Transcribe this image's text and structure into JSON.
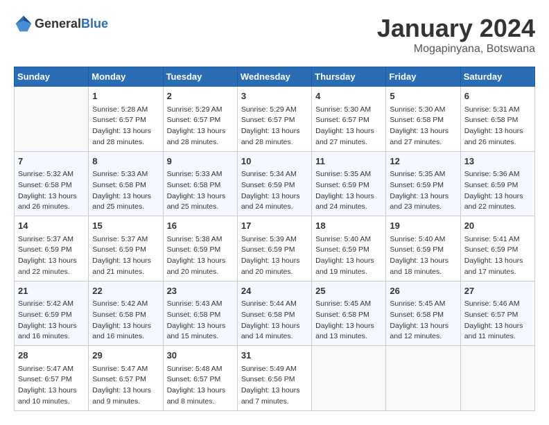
{
  "header": {
    "logo_general": "General",
    "logo_blue": "Blue",
    "title": "January 2024",
    "subtitle": "Mogapinyana, Botswana"
  },
  "days_of_week": [
    "Sunday",
    "Monday",
    "Tuesday",
    "Wednesday",
    "Thursday",
    "Friday",
    "Saturday"
  ],
  "weeks": [
    [
      {
        "day": "",
        "sunrise": "",
        "sunset": "",
        "daylight": ""
      },
      {
        "day": "1",
        "sunrise": "Sunrise: 5:28 AM",
        "sunset": "Sunset: 6:57 PM",
        "daylight": "Daylight: 13 hours and 28 minutes."
      },
      {
        "day": "2",
        "sunrise": "Sunrise: 5:29 AM",
        "sunset": "Sunset: 6:57 PM",
        "daylight": "Daylight: 13 hours and 28 minutes."
      },
      {
        "day": "3",
        "sunrise": "Sunrise: 5:29 AM",
        "sunset": "Sunset: 6:57 PM",
        "daylight": "Daylight: 13 hours and 28 minutes."
      },
      {
        "day": "4",
        "sunrise": "Sunrise: 5:30 AM",
        "sunset": "Sunset: 6:57 PM",
        "daylight": "Daylight: 13 hours and 27 minutes."
      },
      {
        "day": "5",
        "sunrise": "Sunrise: 5:30 AM",
        "sunset": "Sunset: 6:58 PM",
        "daylight": "Daylight: 13 hours and 27 minutes."
      },
      {
        "day": "6",
        "sunrise": "Sunrise: 5:31 AM",
        "sunset": "Sunset: 6:58 PM",
        "daylight": "Daylight: 13 hours and 26 minutes."
      }
    ],
    [
      {
        "day": "7",
        "sunrise": "Sunrise: 5:32 AM",
        "sunset": "Sunset: 6:58 PM",
        "daylight": "Daylight: 13 hours and 26 minutes."
      },
      {
        "day": "8",
        "sunrise": "Sunrise: 5:33 AM",
        "sunset": "Sunset: 6:58 PM",
        "daylight": "Daylight: 13 hours and 25 minutes."
      },
      {
        "day": "9",
        "sunrise": "Sunrise: 5:33 AM",
        "sunset": "Sunset: 6:58 PM",
        "daylight": "Daylight: 13 hours and 25 minutes."
      },
      {
        "day": "10",
        "sunrise": "Sunrise: 5:34 AM",
        "sunset": "Sunset: 6:59 PM",
        "daylight": "Daylight: 13 hours and 24 minutes."
      },
      {
        "day": "11",
        "sunrise": "Sunrise: 5:35 AM",
        "sunset": "Sunset: 6:59 PM",
        "daylight": "Daylight: 13 hours and 24 minutes."
      },
      {
        "day": "12",
        "sunrise": "Sunrise: 5:35 AM",
        "sunset": "Sunset: 6:59 PM",
        "daylight": "Daylight: 13 hours and 23 minutes."
      },
      {
        "day": "13",
        "sunrise": "Sunrise: 5:36 AM",
        "sunset": "Sunset: 6:59 PM",
        "daylight": "Daylight: 13 hours and 22 minutes."
      }
    ],
    [
      {
        "day": "14",
        "sunrise": "Sunrise: 5:37 AM",
        "sunset": "Sunset: 6:59 PM",
        "daylight": "Daylight: 13 hours and 22 minutes."
      },
      {
        "day": "15",
        "sunrise": "Sunrise: 5:37 AM",
        "sunset": "Sunset: 6:59 PM",
        "daylight": "Daylight: 13 hours and 21 minutes."
      },
      {
        "day": "16",
        "sunrise": "Sunrise: 5:38 AM",
        "sunset": "Sunset: 6:59 PM",
        "daylight": "Daylight: 13 hours and 20 minutes."
      },
      {
        "day": "17",
        "sunrise": "Sunrise: 5:39 AM",
        "sunset": "Sunset: 6:59 PM",
        "daylight": "Daylight: 13 hours and 20 minutes."
      },
      {
        "day": "18",
        "sunrise": "Sunrise: 5:40 AM",
        "sunset": "Sunset: 6:59 PM",
        "daylight": "Daylight: 13 hours and 19 minutes."
      },
      {
        "day": "19",
        "sunrise": "Sunrise: 5:40 AM",
        "sunset": "Sunset: 6:59 PM",
        "daylight": "Daylight: 13 hours and 18 minutes."
      },
      {
        "day": "20",
        "sunrise": "Sunrise: 5:41 AM",
        "sunset": "Sunset: 6:59 PM",
        "daylight": "Daylight: 13 hours and 17 minutes."
      }
    ],
    [
      {
        "day": "21",
        "sunrise": "Sunrise: 5:42 AM",
        "sunset": "Sunset: 6:59 PM",
        "daylight": "Daylight: 13 hours and 16 minutes."
      },
      {
        "day": "22",
        "sunrise": "Sunrise: 5:42 AM",
        "sunset": "Sunset: 6:58 PM",
        "daylight": "Daylight: 13 hours and 16 minutes."
      },
      {
        "day": "23",
        "sunrise": "Sunrise: 5:43 AM",
        "sunset": "Sunset: 6:58 PM",
        "daylight": "Daylight: 13 hours and 15 minutes."
      },
      {
        "day": "24",
        "sunrise": "Sunrise: 5:44 AM",
        "sunset": "Sunset: 6:58 PM",
        "daylight": "Daylight: 13 hours and 14 minutes."
      },
      {
        "day": "25",
        "sunrise": "Sunrise: 5:45 AM",
        "sunset": "Sunset: 6:58 PM",
        "daylight": "Daylight: 13 hours and 13 minutes."
      },
      {
        "day": "26",
        "sunrise": "Sunrise: 5:45 AM",
        "sunset": "Sunset: 6:58 PM",
        "daylight": "Daylight: 13 hours and 12 minutes."
      },
      {
        "day": "27",
        "sunrise": "Sunrise: 5:46 AM",
        "sunset": "Sunset: 6:57 PM",
        "daylight": "Daylight: 13 hours and 11 minutes."
      }
    ],
    [
      {
        "day": "28",
        "sunrise": "Sunrise: 5:47 AM",
        "sunset": "Sunset: 6:57 PM",
        "daylight": "Daylight: 13 hours and 10 minutes."
      },
      {
        "day": "29",
        "sunrise": "Sunrise: 5:47 AM",
        "sunset": "Sunset: 6:57 PM",
        "daylight": "Daylight: 13 hours and 9 minutes."
      },
      {
        "day": "30",
        "sunrise": "Sunrise: 5:48 AM",
        "sunset": "Sunset: 6:57 PM",
        "daylight": "Daylight: 13 hours and 8 minutes."
      },
      {
        "day": "31",
        "sunrise": "Sunrise: 5:49 AM",
        "sunset": "Sunset: 6:56 PM",
        "daylight": "Daylight: 13 hours and 7 minutes."
      },
      {
        "day": "",
        "sunrise": "",
        "sunset": "",
        "daylight": ""
      },
      {
        "day": "",
        "sunrise": "",
        "sunset": "",
        "daylight": ""
      },
      {
        "day": "",
        "sunrise": "",
        "sunset": "",
        "daylight": ""
      }
    ]
  ]
}
